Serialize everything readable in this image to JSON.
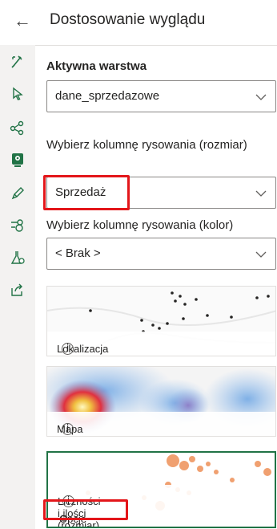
{
  "header": {
    "title": "Dostosowanie wyglądu"
  },
  "layer": {
    "label": "Aktywna warstwa",
    "value": "dane_sprzedazowe"
  },
  "size_column": {
    "label": "Wybierz kolumnę rysowania (rozmiar)",
    "value": "Sprzedaż"
  },
  "color_column": {
    "label": "Wybierz kolumnę rysowania (kolor)",
    "value": "< Brak >"
  },
  "styles": [
    {
      "label": "Lokalizacja (pojedynczy symbol)"
    },
    {
      "label": "Mapa skupień"
    },
    {
      "label": "Liczności i ilości (rozmiar)",
      "style_options": "Opcje stylu"
    }
  ],
  "icons": [
    "back-arrow-icon",
    "paint-icon",
    "pointer-icon",
    "share-nodes-icon",
    "map-pin-icon",
    "pencil-icon",
    "filter-icon",
    "flask-icon",
    "export-icon",
    "chevron-down-icon",
    "info-icon",
    "gear-icon"
  ],
  "colors": {
    "highlight": "#e3161a",
    "selected_border": "#217346"
  }
}
